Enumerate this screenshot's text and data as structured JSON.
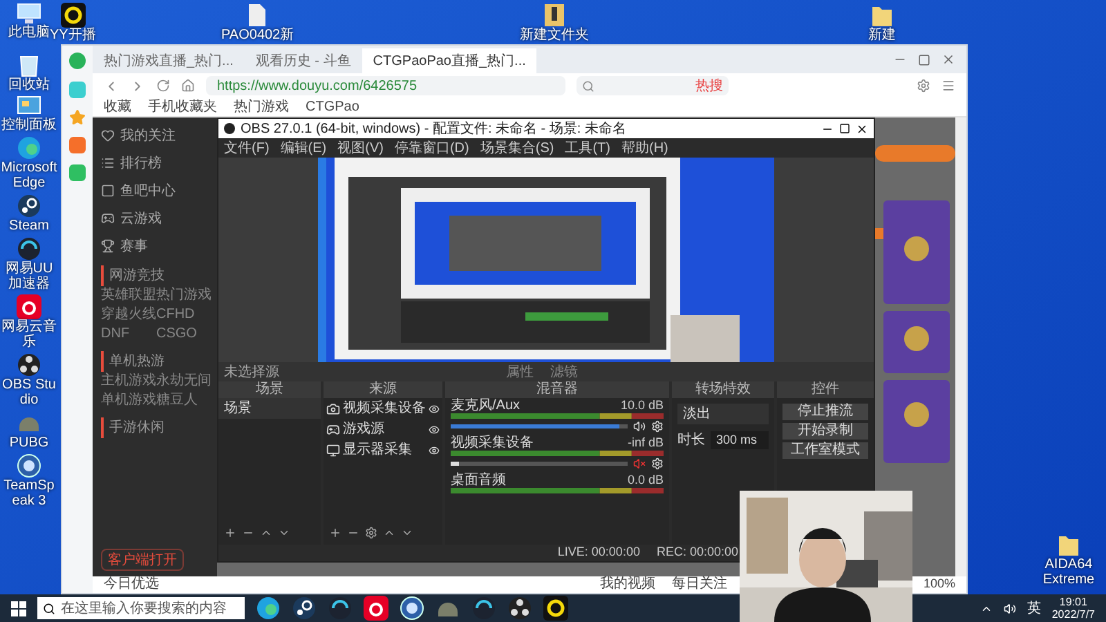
{
  "desktop": {
    "top_icons": [
      {
        "label": "此电脑",
        "kind": "pc"
      },
      {
        "label": "YY开播",
        "kind": "yy"
      },
      {
        "label": "PAO0402新",
        "kind": "file"
      },
      {
        "label": "新建文件夹",
        "kind": "archive"
      },
      {
        "label": "新建",
        "kind": "folder"
      }
    ],
    "left_icons": [
      {
        "label": "回收站",
        "kind": "bin"
      },
      {
        "label": "控制面板",
        "kind": "panel"
      },
      {
        "label": "Microsoft Edge",
        "kind": "edge"
      },
      {
        "label": "Steam",
        "kind": "steam"
      },
      {
        "label": "网易UU加速器",
        "kind": "uu"
      },
      {
        "label": "网易云音乐",
        "kind": "music"
      },
      {
        "label": "OBS Studio",
        "kind": "obs"
      },
      {
        "label": "PUBG",
        "kind": "pubg"
      },
      {
        "label": "TeamSpeak 3",
        "kind": "ts"
      }
    ],
    "corner_icon": {
      "label": "AIDA64 Extreme",
      "kind": "folder"
    }
  },
  "browser": {
    "tabs": [
      {
        "label": "热门游戏直播_热门...",
        "selected": false
      },
      {
        "label": "观看历史 - 斗鱼",
        "selected": false
      },
      {
        "label": "CTGPaoPao直播_热门...",
        "selected": true
      }
    ],
    "url": "https://www.douyu.com/6426575",
    "hot_search": "热搜",
    "bookmarks": [
      "收藏",
      "手机收藏夹",
      "热门游戏",
      "CTGPao"
    ],
    "status_left": "今日优选",
    "status_right": [
      "我的视频",
      "每日关注"
    ],
    "zoom": "100%"
  },
  "site": {
    "nav": [
      "我的关注",
      "排行榜",
      "鱼吧中心",
      "云游戏",
      "赛事"
    ],
    "sections": [
      {
        "title": "网游竞技",
        "items": [
          "英雄联盟",
          "热门游戏",
          "穿越火线",
          "CFHD",
          "DNF",
          "CSGO"
        ]
      },
      {
        "title": "单机热游",
        "items": [
          "主机游戏",
          "永劫无间",
          "单机游戏",
          "糖豆人"
        ]
      },
      {
        "title": "手游休闲"
      }
    ],
    "client_button": "客户端打开"
  },
  "obs": {
    "title": "OBS 27.0.1 (64-bit, windows) - 配置文件: 未命名 - 场景: 未命名",
    "menu": [
      "文件(F)",
      "编辑(E)",
      "视图(V)",
      "停靠窗口(D)",
      "场景集合(S)",
      "工具(T)",
      "帮助(H)"
    ],
    "source_bar": {
      "label": "未选择源",
      "buttons": [
        "属性",
        "滤镜"
      ]
    },
    "docks": [
      "场景",
      "来源",
      "混音器",
      "转场特效",
      "控件"
    ],
    "scenes": [
      "场景"
    ],
    "sources": [
      {
        "name": "视频采集设备",
        "kind": "camera"
      },
      {
        "name": "游戏源",
        "kind": "gamepad"
      },
      {
        "name": "显示器采集",
        "kind": "monitor"
      }
    ],
    "mixer": [
      {
        "name": "麦克风/Aux",
        "reading": "10.0 dB",
        "level": 0.95,
        "muted": false
      },
      {
        "name": "视频采集设备",
        "reading": "-inf dB",
        "level": 0.05,
        "muted": true
      },
      {
        "name": "桌面音频",
        "reading": "0.0 dB"
      }
    ],
    "transition": {
      "value": "淡出",
      "duration_label": "时长",
      "duration": "300 ms"
    },
    "controls": [
      "停止推流",
      "开始录制",
      "工作室模式"
    ],
    "status": {
      "live": "LIVE: 00:00:00",
      "rec": "REC: 00:00:00"
    }
  },
  "taskbar": {
    "search_placeholder": "在这里输入你要搜索的内容",
    "apps": [
      {
        "kind": "edge"
      },
      {
        "kind": "steam"
      },
      {
        "kind": "uu"
      },
      {
        "kind": "music"
      },
      {
        "kind": "ts"
      },
      {
        "kind": "pubg"
      },
      {
        "kind": "uu"
      },
      {
        "kind": "obs"
      },
      {
        "kind": "yy"
      }
    ],
    "ime": "英",
    "time": "19:01",
    "date": "2022/7/7"
  }
}
